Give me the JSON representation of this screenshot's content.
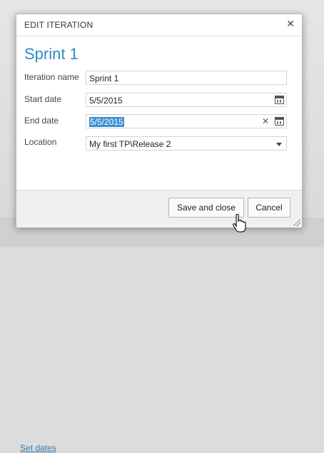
{
  "background": {
    "link_text": "Set dates"
  },
  "dialog": {
    "title": "EDIT ITERATION",
    "close_icon": "close-icon",
    "heading": "Sprint 1",
    "fields": {
      "name": {
        "label": "Iteration name",
        "value": "Sprint 1"
      },
      "start": {
        "label": "Start date",
        "value": "5/5/2015",
        "icon": "calendar-icon"
      },
      "end": {
        "label": "End date",
        "value": "5/5/2015",
        "icon": "calendar-icon",
        "clear_icon": "clear-icon"
      },
      "location": {
        "label": "Location",
        "value": "My first TP\\Release 2",
        "icon": "chevron-down-icon"
      }
    },
    "buttons": {
      "save": "Save and close",
      "cancel": "Cancel"
    }
  },
  "colors": {
    "accent": "#2e8bc3",
    "selection": "#3c8fd2"
  }
}
